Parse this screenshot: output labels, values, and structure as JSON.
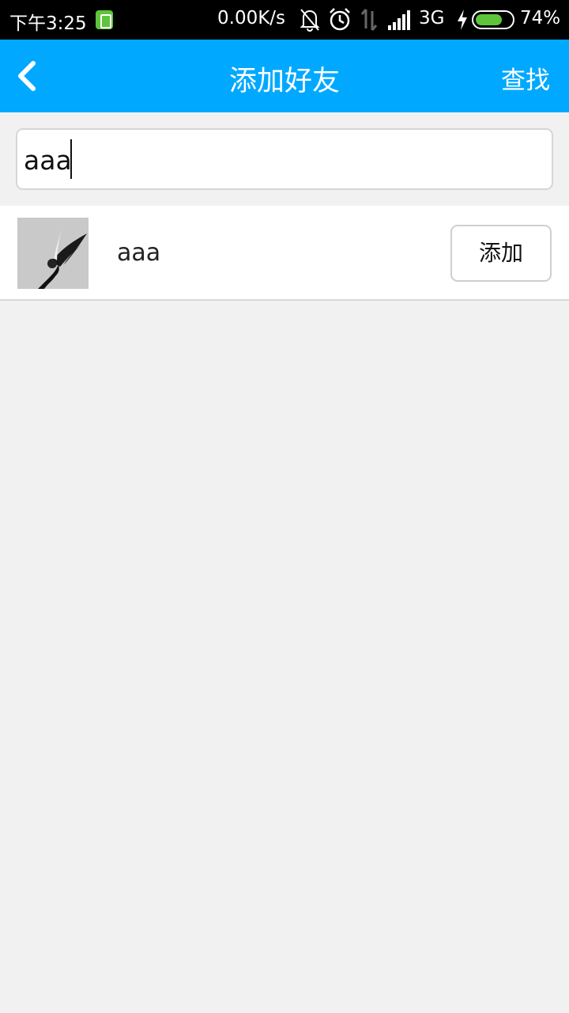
{
  "status_bar": {
    "time": "下午3:25",
    "net_speed": "0.00K/s",
    "network_type": "3G",
    "battery_percent": "74%",
    "battery_level": 0.74,
    "icons": [
      "battery-saver-icon",
      "mute-bell-icon",
      "alarm-icon",
      "data-transfer-icon",
      "signal-icon",
      "charging-icon",
      "battery-icon"
    ]
  },
  "header": {
    "back_icon": "chevron-left-icon",
    "title": "添加好友",
    "search_label": "查找"
  },
  "search": {
    "value": "aaa"
  },
  "results": [
    {
      "avatar_icon": "user-avatar",
      "name": "aaa",
      "add_label": "添加"
    }
  ],
  "colors": {
    "accent": "#00a9ff",
    "background": "#f1f1f1",
    "battery_green": "#5ec43b"
  }
}
